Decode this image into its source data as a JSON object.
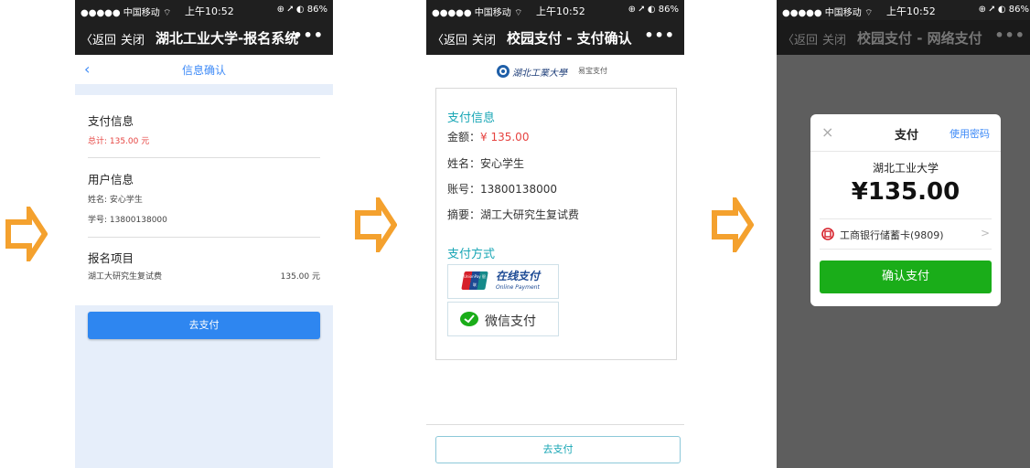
{
  "colors": {
    "arrow": "#f4a12e",
    "blue": "#2e86f0",
    "teal": "#1aa7b6",
    "wechat_green": "#1aad19",
    "price_red": "#e64340"
  },
  "status_bar": {
    "carrier": "●●●●● 中国移动 ⌔",
    "time": "上午10:52",
    "battery": "⊕ ⭧ ◐ 86%"
  },
  "screen1": {
    "nav": {
      "back": "〈返回",
      "close": "关闭",
      "title": "湖北工业大学-报名系统",
      "more": "•••"
    },
    "subhead": {
      "back_icon": "chevron-left-icon",
      "title": "信息确认"
    },
    "payment_info": {
      "heading": "支付信息",
      "total": "总计: 135.00 元"
    },
    "user_info": {
      "heading": "用户信息",
      "name": "姓名: 安心学生",
      "id": "学号: 13800138000"
    },
    "signup": {
      "heading": "报名项目",
      "item": "湖工大研究生复试费",
      "price": "135.00 元"
    },
    "pay_button": "去支付"
  },
  "screen2": {
    "nav": {
      "back": "〈返回",
      "close": "关闭",
      "title": "校园支付 - 支付确认",
      "more": "•••"
    },
    "logo": {
      "school": "湖北工業大學",
      "epay": "易宝支付"
    },
    "payment_info": {
      "heading": "支付信息",
      "amount_label": "金额：",
      "amount": "¥ 135.00",
      "name": "姓名：安心学生",
      "account": "账号：13800138000",
      "memo": "摘要：湖工大研究生复试费"
    },
    "methods": {
      "heading": "支付方式",
      "unionpay_cn": "在线支付",
      "unionpay_en": "Online Payment",
      "unionpay_logo": "UnionPay 银联",
      "wechat": "微信支付"
    },
    "pay_button": "去支付"
  },
  "screen3": {
    "nav": {
      "back": "〈返回",
      "close": "关闭",
      "title": "校园支付 - 网络支付",
      "more": "•••"
    },
    "modal": {
      "close": "×",
      "title": "支付",
      "use_password": "使用密码",
      "merchant": "湖北工业大学",
      "amount": "¥135.00",
      "card": "工商银行储蓄卡(9809)",
      "chevron": ">",
      "confirm": "确认支付"
    }
  }
}
